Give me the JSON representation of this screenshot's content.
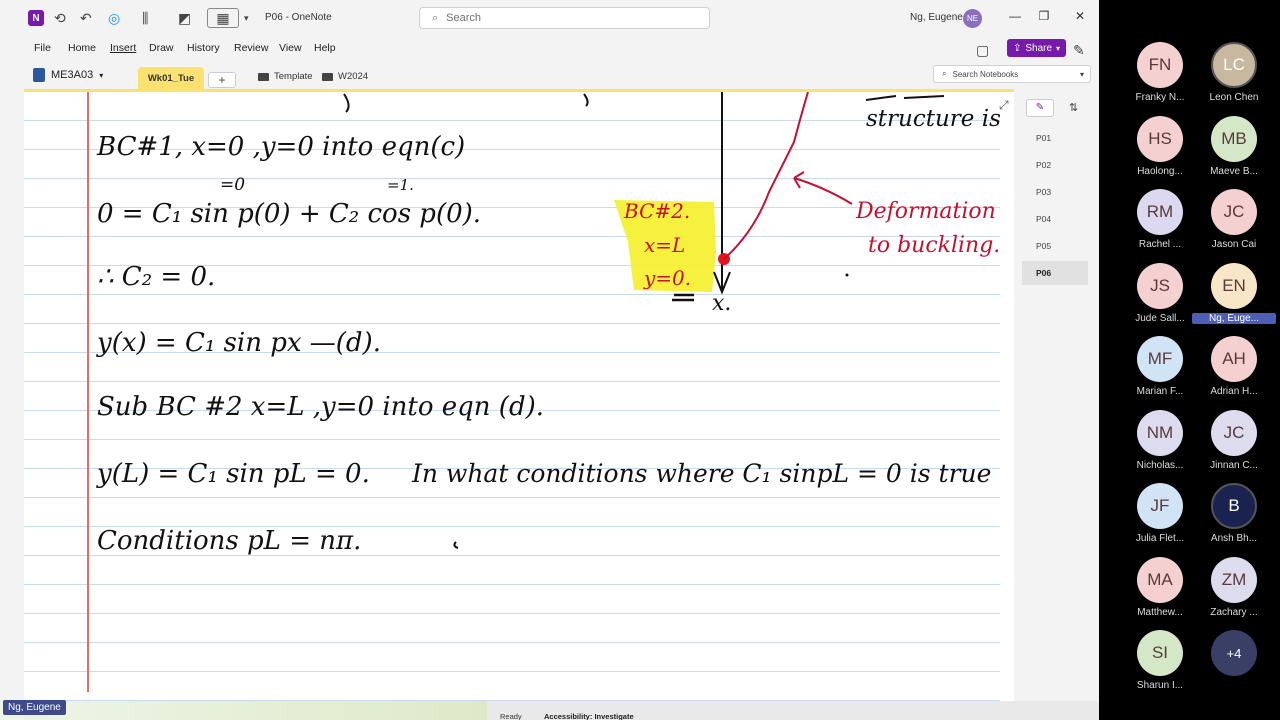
{
  "window": {
    "doc_title": "P06  -  OneNote",
    "search_placeholder": "Search",
    "user_name": "Ng, Eugene",
    "user_initials": "NE",
    "app_logo": "N"
  },
  "menu": [
    "File",
    "Home",
    "Insert",
    "Draw",
    "History",
    "Review",
    "View",
    "Help"
  ],
  "share_label": "Share",
  "notebook": {
    "name": "ME3A03",
    "active_section": "Wk01_Tue",
    "add_section": "+",
    "groups": [
      "Template",
      "W2024"
    ],
    "search_placeholder": "Search Notebooks"
  },
  "pages": [
    "P01",
    "P02",
    "P03",
    "P04",
    "P05",
    "P06"
  ],
  "active_page": "P06",
  "note_lines": {
    "bc1": "BC#1,  x=0 ,y=0  into eqn(c)",
    "annot_zero": "=0",
    "annot_one": "=1.",
    "eq0": "0 = C₁ sin p(0) + C₂ cos p(0).",
    "therefore": "∴  C₂ = 0.",
    "yx": "y(x) = C₁ sin px  —(d).",
    "sub": "Sub  BC #2   x=L ,y=0  into  eqn (d).",
    "yl": "y(L) = C₁ sin pL = 0.",
    "question": "In  what  conditions  where  C₁ sinpL = 0  is  true",
    "conditions": "Conditions   pL = nπ.",
    "structure": "structure  is",
    "bc2": "BC#2.",
    "bc2_x": "x=L",
    "bc2_y": "y=0.",
    "axis_x": "x.",
    "deformation": "Deformation",
    "buckling": "to buckling."
  },
  "status": {
    "ready": "Ready",
    "accessibility": "Accessibility: Investigate"
  },
  "presenter": "Ng, Eugene",
  "participants": [
    {
      "initials": "FN",
      "name": "Franky N...",
      "color": "#f5d0d0",
      "photo": false,
      "highlight": false
    },
    {
      "initials": "LC",
      "name": "Leon Chen",
      "color": "#c9b8a0",
      "photo": true,
      "highlight": false
    },
    {
      "initials": "HS",
      "name": "Haolong...",
      "color": "#f5d0d0",
      "photo": false,
      "highlight": false
    },
    {
      "initials": "MB",
      "name": "Maeve B...",
      "color": "#d4e8c8",
      "photo": false,
      "highlight": false
    },
    {
      "initials": "RM",
      "name": "Rachel ...",
      "color": "#dcd8f0",
      "photo": false,
      "highlight": false
    },
    {
      "initials": "JC",
      "name": "Jason Cai",
      "color": "#f5d0d0",
      "photo": false,
      "highlight": false
    },
    {
      "initials": "JS",
      "name": "Jude Sall...",
      "color": "#f5d0d0",
      "photo": false,
      "highlight": false
    },
    {
      "initials": "EN",
      "name": "Ng, Euge...",
      "color": "#f8e6c8",
      "photo": false,
      "highlight": true
    },
    {
      "initials": "MF",
      "name": "Marian F...",
      "color": "#d0e4f5",
      "photo": false,
      "highlight": false
    },
    {
      "initials": "AH",
      "name": "Adrian H...",
      "color": "#f5d0d0",
      "photo": false,
      "highlight": false
    },
    {
      "initials": "NM",
      "name": "Nicholas...",
      "color": "#dcdcee",
      "photo": false,
      "highlight": false
    },
    {
      "initials": "JC",
      "name": "Jinnan C...",
      "color": "#dcdcee",
      "photo": false,
      "highlight": false
    },
    {
      "initials": "JF",
      "name": "Julia Flet...",
      "color": "#d0e4f5",
      "photo": false,
      "highlight": false
    },
    {
      "initials": "B",
      "name": "Ansh Bh...",
      "color": "#1a2250",
      "photo": true,
      "highlight": false
    },
    {
      "initials": "MA",
      "name": "Matthew...",
      "color": "#f5d0d0",
      "photo": false,
      "highlight": false
    },
    {
      "initials": "ZM",
      "name": "Zachary ...",
      "color": "#dcdcee",
      "photo": false,
      "highlight": false
    },
    {
      "initials": "SI",
      "name": "Sharun I...",
      "color": "#d4e8c8",
      "photo": false,
      "highlight": false
    },
    {
      "initials": "+4",
      "name": "",
      "color": "#3a3f66",
      "photo": false,
      "highlight": false
    }
  ]
}
